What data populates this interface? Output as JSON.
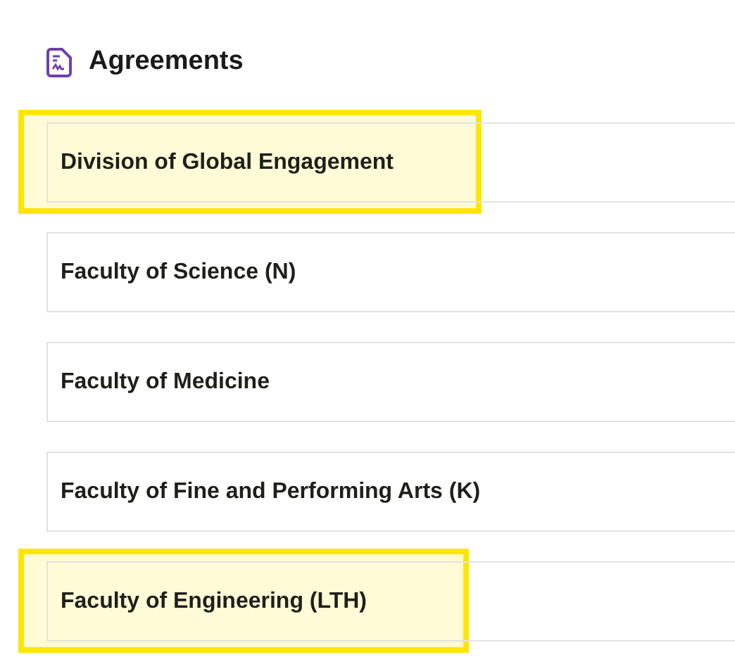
{
  "section": {
    "title": "Agreements"
  },
  "items": [
    {
      "label": "Division of Global Engagement",
      "highlighted": true
    },
    {
      "label": "Faculty of Science (N)",
      "highlighted": false
    },
    {
      "label": "Faculty of Medicine",
      "highlighted": false
    },
    {
      "label": "Faculty of Fine and Performing Arts (K)",
      "highlighted": false
    },
    {
      "label": "Faculty of Engineering (LTH)",
      "highlighted": true
    }
  ]
}
